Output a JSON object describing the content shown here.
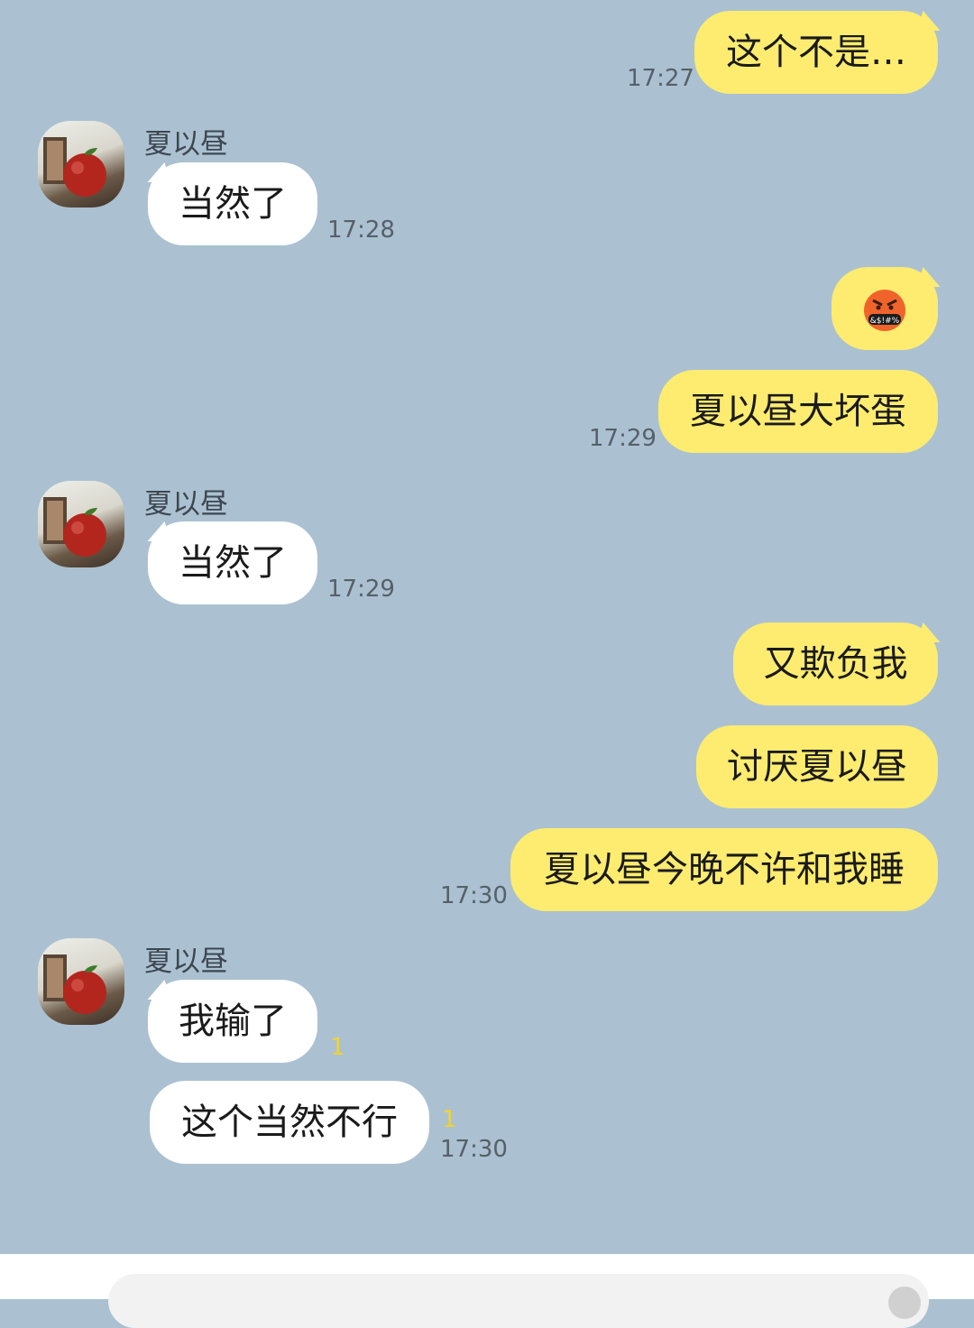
{
  "contact": {
    "name": "夏以昼"
  },
  "messages": [
    {
      "side": "out",
      "text": "这个不是…",
      "time": "17:27"
    },
    {
      "side": "in",
      "sender": "夏以昼",
      "text": "当然了",
      "time": "17:28"
    },
    {
      "side": "out",
      "emoji": "angry-cursing-face",
      "emoji_text": "&$!#%"
    },
    {
      "side": "out",
      "text": "夏以昼大坏蛋",
      "time": "17:29"
    },
    {
      "side": "in",
      "sender": "夏以昼",
      "text": "当然了",
      "time": "17:29"
    },
    {
      "side": "out",
      "text": "又欺负我"
    },
    {
      "side": "out",
      "text": "讨厌夏以昼"
    },
    {
      "side": "out",
      "text": "夏以昼今晚不许和我睡",
      "time": "17:30"
    },
    {
      "side": "in",
      "sender": "夏以昼",
      "text": "我输了",
      "unread": "1"
    },
    {
      "side": "in",
      "text": "这个当然不行",
      "unread": "1",
      "time": "17:30"
    }
  ],
  "colors": {
    "background": "#abc1d1",
    "outgoing_bubble": "#fdec6f",
    "incoming_bubble": "#ffffff",
    "unread": "#f0d23a"
  }
}
